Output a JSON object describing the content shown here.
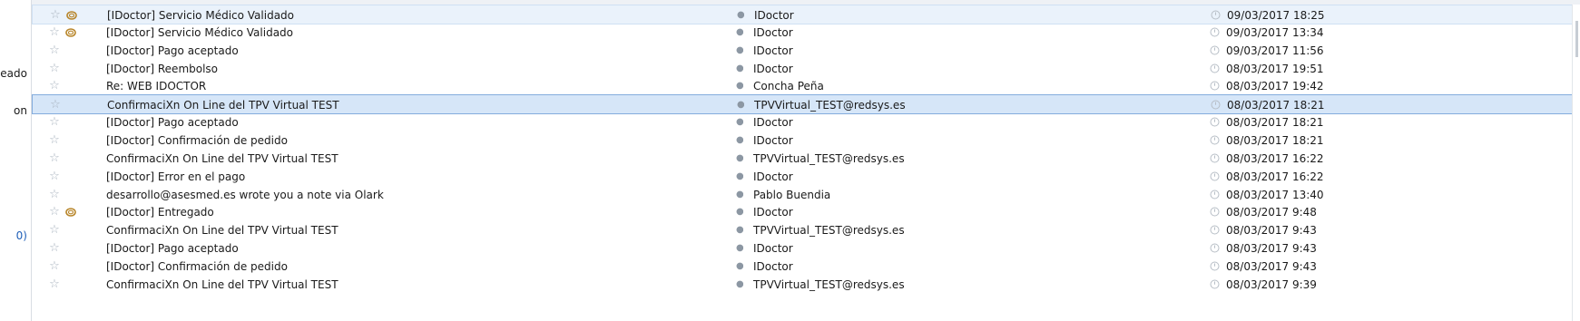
{
  "left_pane": {
    "items": [
      {
        "label": "seado",
        "blue": false
      },
      {
        "label": "on",
        "blue": false
      },
      {
        "label": "0)",
        "blue": true
      }
    ]
  },
  "messages": [
    {
      "subject": "[IDoctor] Servicio Médico Validado",
      "sender": "IDoctor",
      "date": "09/03/2017 18:25",
      "attachment": true,
      "state": "hover"
    },
    {
      "subject": "[IDoctor] Servicio Médico Validado",
      "sender": "IDoctor",
      "date": "09/03/2017 13:34",
      "attachment": true,
      "state": ""
    },
    {
      "subject": "[IDoctor] Pago aceptado",
      "sender": "IDoctor",
      "date": "09/03/2017 11:56",
      "attachment": false,
      "state": ""
    },
    {
      "subject": "[IDoctor] Reembolso",
      "sender": "IDoctor",
      "date": "08/03/2017 19:51",
      "attachment": false,
      "state": ""
    },
    {
      "subject": "Re: WEB IDOCTOR",
      "sender": "Concha Peña",
      "date": "08/03/2017 19:42",
      "attachment": false,
      "state": ""
    },
    {
      "subject": "ConfirmaciXn On Line del TPV Virtual TEST",
      "sender": "TPVVirtual_TEST@redsys.es",
      "date": "08/03/2017 18:21",
      "attachment": false,
      "state": "selected"
    },
    {
      "subject": "[IDoctor] Pago aceptado",
      "sender": "IDoctor",
      "date": "08/03/2017 18:21",
      "attachment": false,
      "state": ""
    },
    {
      "subject": "[IDoctor] Confirmación de pedido",
      "sender": "IDoctor",
      "date": "08/03/2017 18:21",
      "attachment": false,
      "state": ""
    },
    {
      "subject": "ConfirmaciXn On Line del TPV Virtual TEST",
      "sender": "TPVVirtual_TEST@redsys.es",
      "date": "08/03/2017 16:22",
      "attachment": false,
      "state": ""
    },
    {
      "subject": "[IDoctor] Error en el pago",
      "sender": "IDoctor",
      "date": "08/03/2017 16:22",
      "attachment": false,
      "state": ""
    },
    {
      "subject": "desarrollo@asesmed.es wrote you a note via Olark",
      "sender": "Pablo Buendia",
      "date": "08/03/2017 13:40",
      "attachment": false,
      "state": ""
    },
    {
      "subject": "[IDoctor] Entregado",
      "sender": "IDoctor",
      "date": "08/03/2017 9:48",
      "attachment": true,
      "state": ""
    },
    {
      "subject": "ConfirmaciXn On Line del TPV Virtual TEST",
      "sender": "TPVVirtual_TEST@redsys.es",
      "date": "08/03/2017 9:43",
      "attachment": false,
      "state": ""
    },
    {
      "subject": "[IDoctor] Pago aceptado",
      "sender": "IDoctor",
      "date": "08/03/2017 9:43",
      "attachment": false,
      "state": ""
    },
    {
      "subject": "[IDoctor] Confirmación de pedido",
      "sender": "IDoctor",
      "date": "08/03/2017 9:43",
      "attachment": false,
      "state": ""
    },
    {
      "subject": "ConfirmaciXn On Line del TPV Virtual TEST",
      "sender": "TPVVirtual_TEST@redsys.es",
      "date": "08/03/2017 9:39",
      "attachment": false,
      "state": ""
    }
  ],
  "icons": {
    "star": "star-icon",
    "attachment": "paperclip-icon",
    "junk_status": "junk-status-icon",
    "read_status": "unread-dot-icon"
  },
  "colors": {
    "selected_bg": "#d6e6f8",
    "selected_border": "#84acdd",
    "hover_bg": "#eaf2fb",
    "attachment": "#b8862b"
  }
}
